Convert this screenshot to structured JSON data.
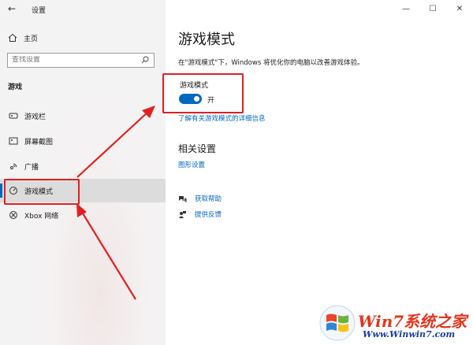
{
  "window": {
    "back_glyph": "←",
    "title": "设置",
    "controls": {
      "minimize": "—",
      "maximize": "☐",
      "close": "✕"
    }
  },
  "sidebar": {
    "home_label": "主页",
    "search_placeholder": "查找设置",
    "section_title": "游戏",
    "items": [
      {
        "label": "游戏栏",
        "icon": "game-bar-icon"
      },
      {
        "label": "屏幕截图",
        "icon": "screenshot-icon"
      },
      {
        "label": "广播",
        "icon": "broadcast-icon"
      },
      {
        "label": "游戏模式",
        "icon": "game-mode-icon",
        "active": true
      },
      {
        "label": "Xbox 网络",
        "icon": "xbox-icon"
      }
    ]
  },
  "main": {
    "title": "游戏模式",
    "description": "在\"游戏模式\"下，Windows 将优化你的电脑以改善游戏体验。",
    "toggle": {
      "label": "游戏模式",
      "state_text": "开",
      "on": true
    },
    "learn_more": "了解有关游戏模式的详细信息",
    "related_title": "相关设置",
    "graphics_link": "图形设置",
    "help_links": [
      {
        "label": "获取帮助",
        "icon": "help-chat-icon"
      },
      {
        "label": "提供反馈",
        "icon": "feedback-icon"
      }
    ]
  },
  "watermark": {
    "brand": "Win7系统之家",
    "url": "Www.Winwin7.com"
  },
  "colors": {
    "accent": "#0067c0",
    "annotation_red": "#e02020"
  }
}
